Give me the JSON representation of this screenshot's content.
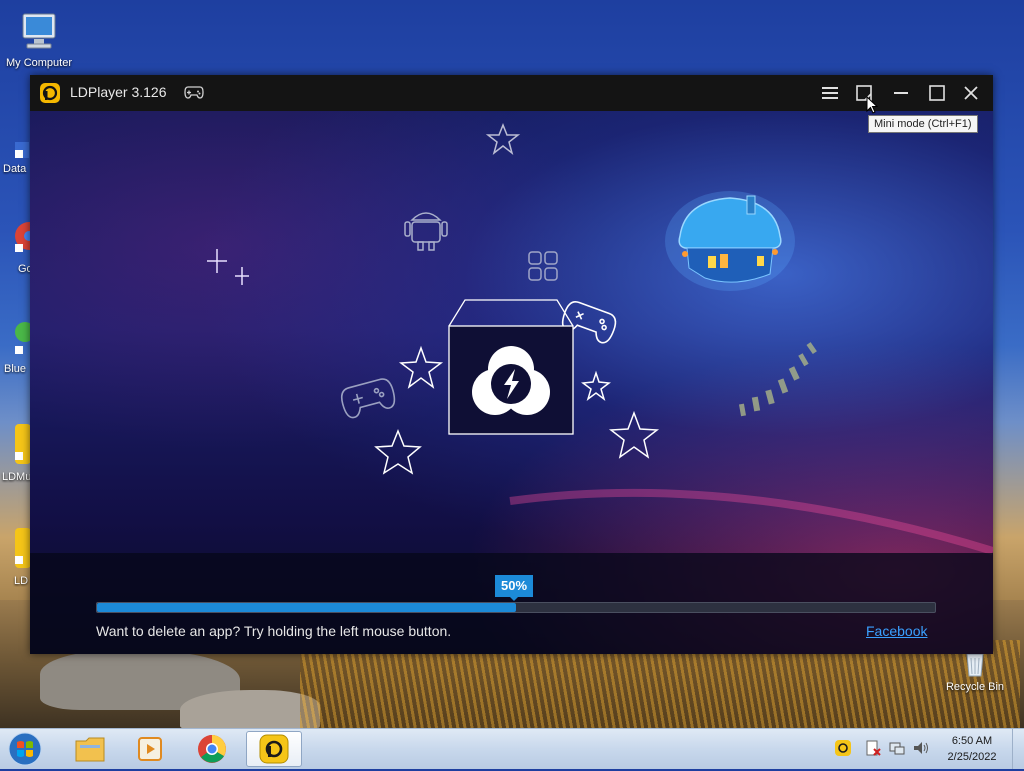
{
  "desktop": {
    "icons": [
      {
        "label": "My Computer"
      },
      {
        "label": "Data"
      },
      {
        "label": "Go Ch"
      },
      {
        "label": "Blue"
      },
      {
        "label": "LDMu"
      },
      {
        "label": "LD"
      },
      {
        "label": "Recycle Bin"
      }
    ]
  },
  "window": {
    "title": "LDPlayer 3.126",
    "tooltip": "Mini mode (Ctrl+F1)",
    "loading": {
      "percent_label": "50%",
      "progress": 0.5,
      "tip": "Want to delete an app? Try holding the left mouse button.",
      "link": "Facebook"
    }
  },
  "taskbar": {
    "time": "6:50 AM",
    "date": "2/25/2022"
  },
  "colors": {
    "accent": "#1c8ad8",
    "link": "#3aa0ff",
    "titlebar": "#141414"
  }
}
